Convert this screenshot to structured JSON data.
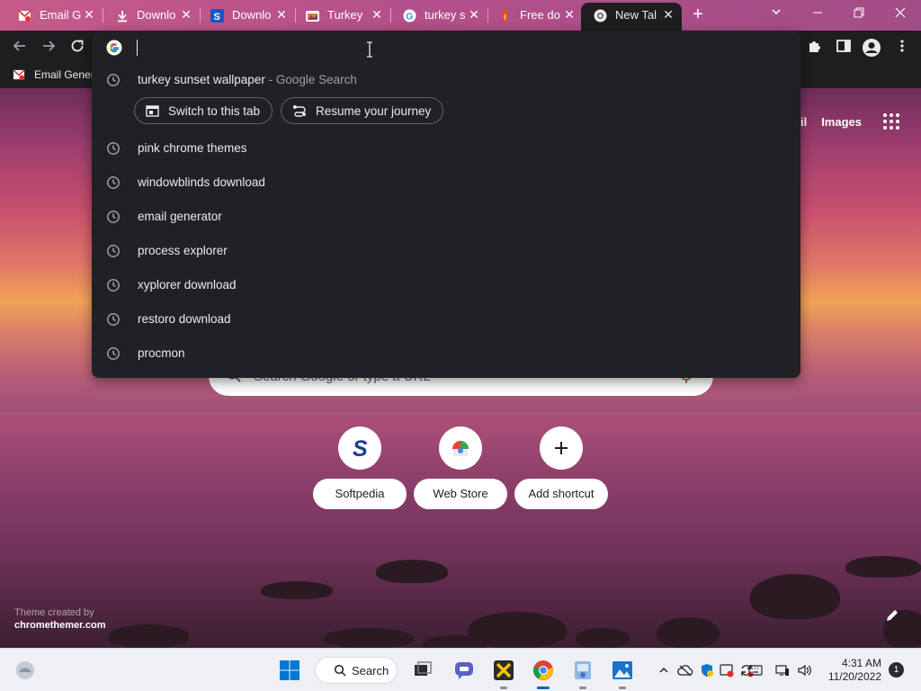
{
  "tabs": [
    {
      "title": "Email G",
      "favicon": "email-generator-favicon",
      "active": false
    },
    {
      "title": "Downlo",
      "favicon": "download-icon",
      "active": false
    },
    {
      "title": "Downlo",
      "favicon": "softpedia-favicon",
      "active": false
    },
    {
      "title": "Turkey",
      "favicon": "turkey-site-favicon",
      "active": false
    },
    {
      "title": "turkey s",
      "favicon": "google-favicon",
      "active": false
    },
    {
      "title": "Free do",
      "favicon": "free-download-favicon",
      "active": false
    },
    {
      "title": "New Tal",
      "favicon": "chrome-favicon",
      "active": true
    }
  ],
  "bookmarks": [
    {
      "label": "Email Gener"
    }
  ],
  "omnibox": {
    "input_value": "",
    "suggestions": [
      {
        "text": "turkey sunset wallpaper",
        "suffix": " - Google Search"
      },
      {
        "text": "pink chrome themes",
        "suffix": ""
      },
      {
        "text": "windowblinds download",
        "suffix": ""
      },
      {
        "text": "email generator",
        "suffix": ""
      },
      {
        "text": "process explorer",
        "suffix": ""
      },
      {
        "text": "xyplorer download",
        "suffix": ""
      },
      {
        "text": "restoro download",
        "suffix": ""
      },
      {
        "text": "procmon",
        "suffix": ""
      }
    ],
    "actions": [
      {
        "label": "Switch to this tab",
        "icon": "switch-tab-icon"
      },
      {
        "label": "Resume your journey",
        "icon": "journey-icon"
      }
    ]
  },
  "ntp": {
    "top_links": {
      "gmail_partial": "il",
      "images": "Images"
    },
    "search_placeholder": "Search Google or type a URL",
    "shortcuts": [
      {
        "label": "Softpedia",
        "icon": "softpedia-icon"
      },
      {
        "label": "Web Store",
        "icon": "web-store-icon"
      },
      {
        "label": "Add shortcut",
        "icon": "plus-icon"
      }
    ],
    "theme_credit_line1": "Theme created by",
    "theme_credit_line2": "chromethemer.com"
  },
  "taskbar": {
    "search_label": "Search",
    "time": "4:31 AM",
    "date": "11/20/2022",
    "notification_count": "1"
  },
  "colors": {
    "omnibox_bg": "#202124",
    "toolbar_bg": "#1e1e21",
    "tabstrip": "#b4508a",
    "taskbar_bg": "#eef0f3",
    "win11_blue": "#0067c0"
  }
}
